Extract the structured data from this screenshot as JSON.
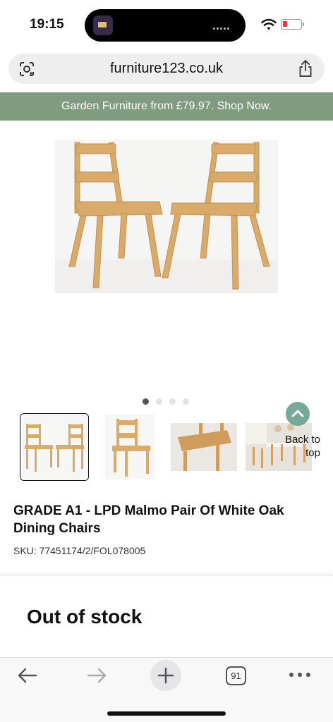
{
  "status_bar": {
    "time": "19:15"
  },
  "browser": {
    "url": "furniture123.co.uk",
    "open_tabs": "91"
  },
  "promo_banner": {
    "text": "Garden Furniture from £79.97. Shop Now."
  },
  "gallery": {
    "image_count": 4,
    "active_index": 0
  },
  "back_to_top": {
    "label": "Back to top"
  },
  "product": {
    "title": "GRADE A1 - LPD Malmo Pair Of White Oak Dining Chairs",
    "sku": "SKU: 77451174/2/FOL078005"
  },
  "stock": {
    "status": "Out of stock"
  },
  "colors": {
    "promo_green": "#7f9d7e",
    "back_to_top_teal": "#76a99a",
    "battery_low": "#e23b3b"
  },
  "icons": [
    "wifi-icon",
    "battery-icon",
    "google-lens-icon",
    "share-icon",
    "chevron-up-icon",
    "back-arrow-icon",
    "forward-arrow-icon",
    "plus-icon",
    "tabs-icon",
    "more-icon"
  ]
}
